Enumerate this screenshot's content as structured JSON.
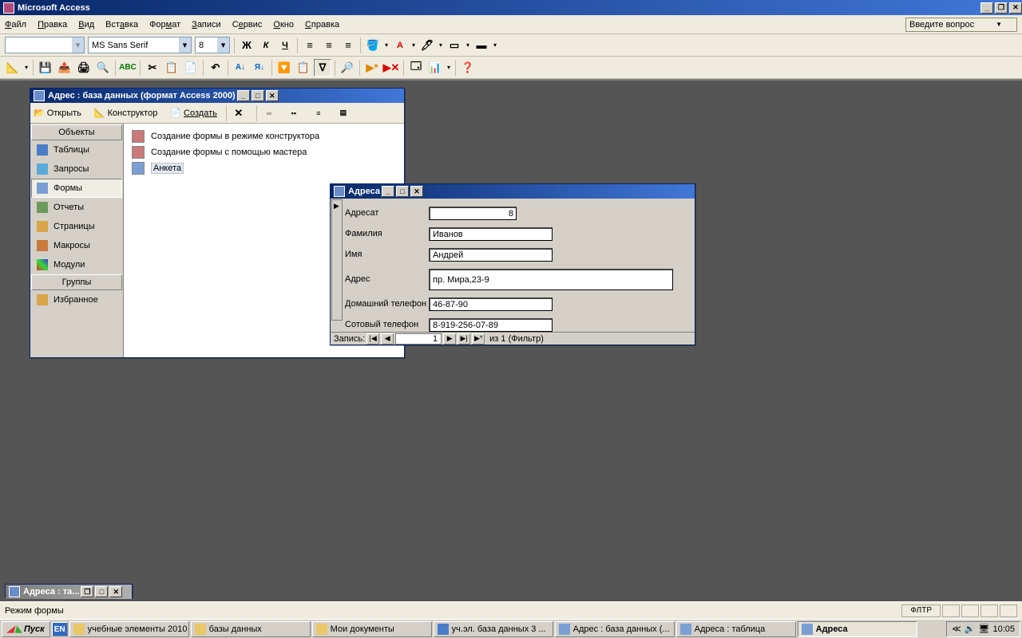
{
  "app": {
    "title": "Microsoft Access"
  },
  "menu": {
    "items": [
      "Файл",
      "Правка",
      "Вид",
      "Вставка",
      "Формат",
      "Записи",
      "Сервис",
      "Окно",
      "Справка"
    ],
    "askbox": "Введите вопрос"
  },
  "format_toolbar": {
    "font": "MS Sans Serif",
    "size": "8"
  },
  "db_window": {
    "title": "Адрес : база данных (формат Access 2000)",
    "toolbar": {
      "open": "Открыть",
      "design": "Конструктор",
      "create": "Создать"
    },
    "sidebar": {
      "objects": "Объекты",
      "items": [
        "Таблицы",
        "Запросы",
        "Формы",
        "Отчеты",
        "Страницы",
        "Макросы",
        "Модули"
      ],
      "groups": "Группы",
      "fav": "Избранное"
    },
    "list": {
      "item1": "Создание формы в режиме конструктора",
      "item2": "Создание формы с помощью мастера",
      "item3": "Анкета"
    }
  },
  "form_window": {
    "title": "Адреса",
    "fields": {
      "f1_label": "Адресат",
      "f1_val": "8",
      "f2_label": "Фамилия",
      "f2_val": "Иванов",
      "f3_label": "Имя",
      "f3_val": "Андрей",
      "f4_label": "Адрес",
      "f4_val": "пр. Мира,23-9",
      "f5_label": "Домашний телефон",
      "f5_val": "46-87-90",
      "f6_label": "Сотовый телефон",
      "f6_val": "8-919-256-07-89"
    },
    "nav": {
      "label": "Запись:",
      "current": "1",
      "total": "из  1 (Фильтр)"
    }
  },
  "min_window": {
    "title": "Адреса : та..."
  },
  "status": {
    "mode": "Режим формы",
    "filter": "ФЛТР"
  },
  "taskbar": {
    "start": "Пуск",
    "lang": "EN",
    "items": [
      "учебные элементы 2010",
      "базы данных",
      "Мои документы",
      "уч.эл. база данных 3 ...",
      "Адрес : база данных (...",
      "Адреса : таблица",
      "Адреса"
    ],
    "time": "10:05"
  }
}
